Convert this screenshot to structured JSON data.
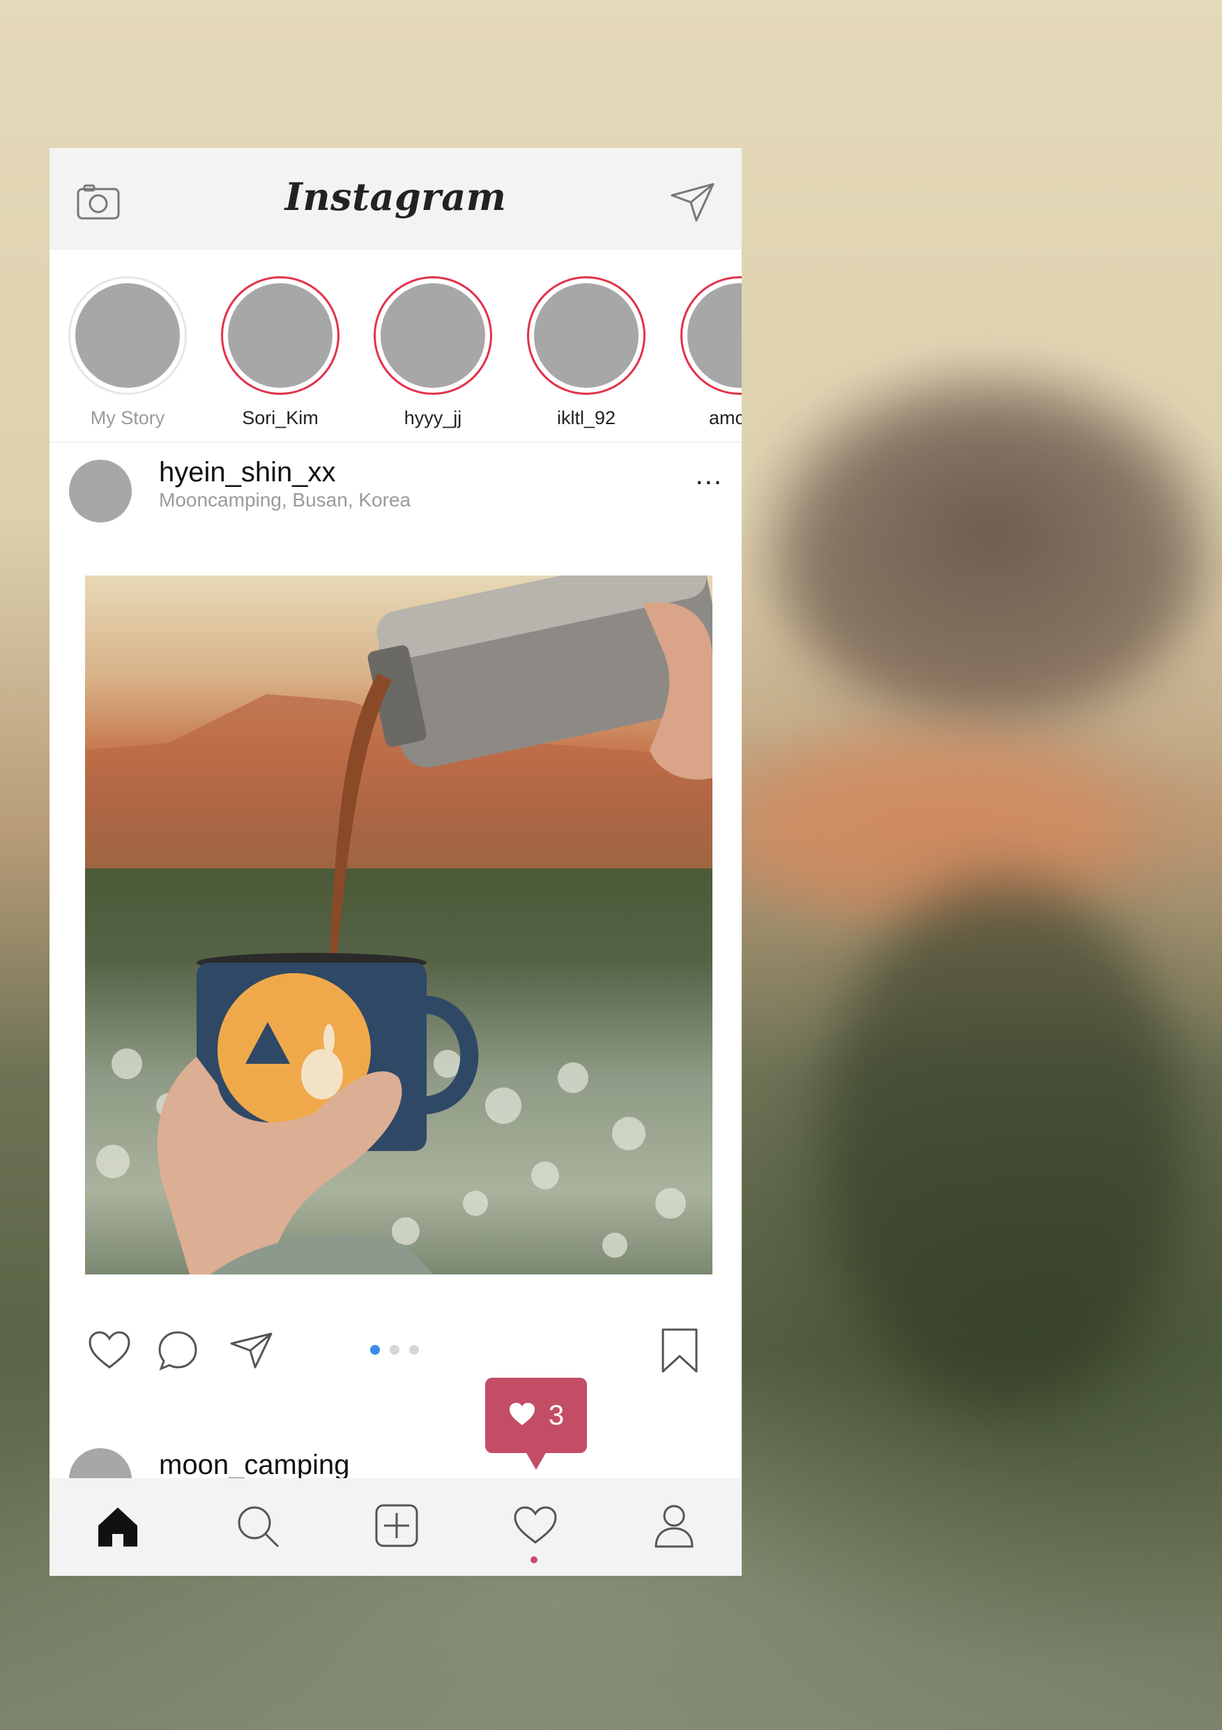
{
  "header": {
    "title": "Instagram",
    "left_icon": "camera-icon",
    "right_icon": "send-icon"
  },
  "stories": [
    {
      "label": "My Story",
      "mine": true
    },
    {
      "label": "Sori_Kim"
    },
    {
      "label": "hyyy_jj"
    },
    {
      "label": "ikltl_92"
    },
    {
      "label": "amo"
    }
  ],
  "post": {
    "username": "hyein_shin_xx",
    "location": "Mooncamping, Busan,  Korea",
    "more": "...",
    "image_alt": "Coffee poured from a thermos into a blue enamel mug held in a hand outdoors",
    "carousel": {
      "count": 3,
      "active": 0
    }
  },
  "next_post": {
    "username": "moon_camping"
  },
  "notification": {
    "count": "3",
    "icon": "heart-icon"
  },
  "bottom_nav": [
    "home-icon",
    "search-icon",
    "add-icon",
    "heart-icon",
    "profile-icon"
  ],
  "colors": {
    "story_ring": "#e2324a",
    "badge": "#c44d66",
    "active_dot": "#3b8ce8",
    "bar_bg": "#f3f3f3"
  }
}
